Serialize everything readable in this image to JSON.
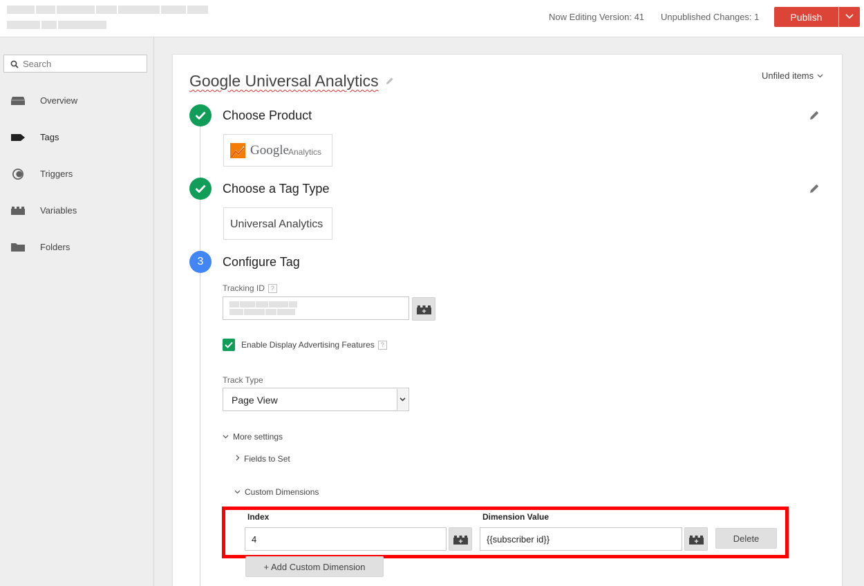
{
  "header": {
    "version_label": "Now Editing Version: 41",
    "changes_label": "Unpublished Changes: 1",
    "publish_label": "Publish",
    "colors": {
      "publish": "#db4437"
    }
  },
  "sidebar": {
    "search_placeholder": "Search",
    "items": [
      {
        "label": "Overview",
        "icon": "overview-icon",
        "active": false
      },
      {
        "label": "Tags",
        "icon": "tag-icon",
        "active": true
      },
      {
        "label": "Triggers",
        "icon": "trigger-icon",
        "active": false
      },
      {
        "label": "Variables",
        "icon": "variable-brick-icon",
        "active": false
      },
      {
        "label": "Folders",
        "icon": "folder-icon",
        "active": false
      }
    ]
  },
  "tag": {
    "name": "Google Universal Analytics",
    "folder": "Unfiled items"
  },
  "steps": [
    {
      "title": "Choose Product",
      "status": "done"
    },
    {
      "title": "Choose a Tag Type",
      "status": "done"
    },
    {
      "title": "Configure Tag",
      "status": "active",
      "number": "3"
    }
  ],
  "product": {
    "logo_word": "Google",
    "logo_sub": "Analytics",
    "colors": {
      "logo_orange": "#f57c00",
      "logo_dark": "#e65100"
    }
  },
  "tag_type": {
    "label": "Universal Analytics"
  },
  "config": {
    "tracking_id_label": "Tracking ID",
    "help_glyph": "?",
    "display_ads_label": "Enable Display Advertising Features",
    "display_ads_checked": true,
    "track_type_label": "Track Type",
    "track_type_value": "Page View",
    "more_settings": "More settings",
    "fields_to_set": "Fields to Set",
    "custom_dimensions": "Custom Dimensions",
    "dimension_table": {
      "index_header": "Index",
      "value_header": "Dimension Value",
      "rows": [
        {
          "index": "4",
          "value": "{{subscriber id}}"
        }
      ],
      "delete_label": "Delete"
    },
    "add_dimension_label": "+ Add Custom Dimension",
    "colors": {
      "check": "#0f9d58",
      "step_active": "#4285f4",
      "highlight": "#ff0000"
    }
  }
}
